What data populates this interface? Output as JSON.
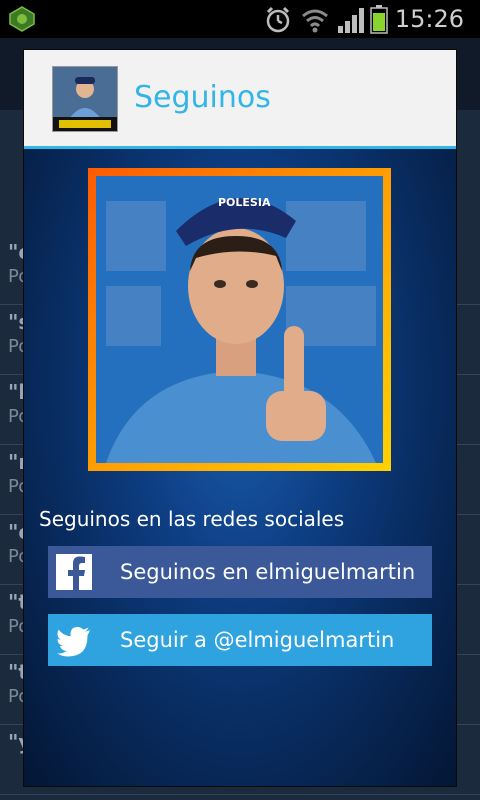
{
  "status_bar": {
    "time": "15:26",
    "icons": [
      "app-icon",
      "alarm-icon",
      "wifi-icon",
      "signal-icon",
      "battery-icon"
    ]
  },
  "background_app": {
    "rows": [
      {
        "quote": "\"c",
        "sub": "Po"
      },
      {
        "quote": "\"s",
        "sub": "Po"
      },
      {
        "quote": "\"h",
        "sub": "Po"
      },
      {
        "quote": "\"n",
        "sub": "Po"
      },
      {
        "quote": "\"c",
        "sub": "Po"
      },
      {
        "quote": "\"t",
        "sub": "Po"
      },
      {
        "quote": "\"t",
        "sub": "Po"
      },
      {
        "quote": "\"y",
        "sub": ""
      }
    ]
  },
  "dialog": {
    "title": "Seguinos",
    "logo_icon": "gordillo-logo",
    "photo": "profile-photo",
    "social_label": "Seguinos en las redes sociales",
    "facebook_button": {
      "label": "Seguinos en elmiguelmartin",
      "icon": "facebook-icon"
    },
    "twitter_button": {
      "label": "Seguir a @elmiguelmartin",
      "icon": "twitter-icon"
    }
  },
  "colors": {
    "accent": "#33b5e5",
    "facebook": "#3b5998",
    "twitter": "#2fa3e0"
  }
}
